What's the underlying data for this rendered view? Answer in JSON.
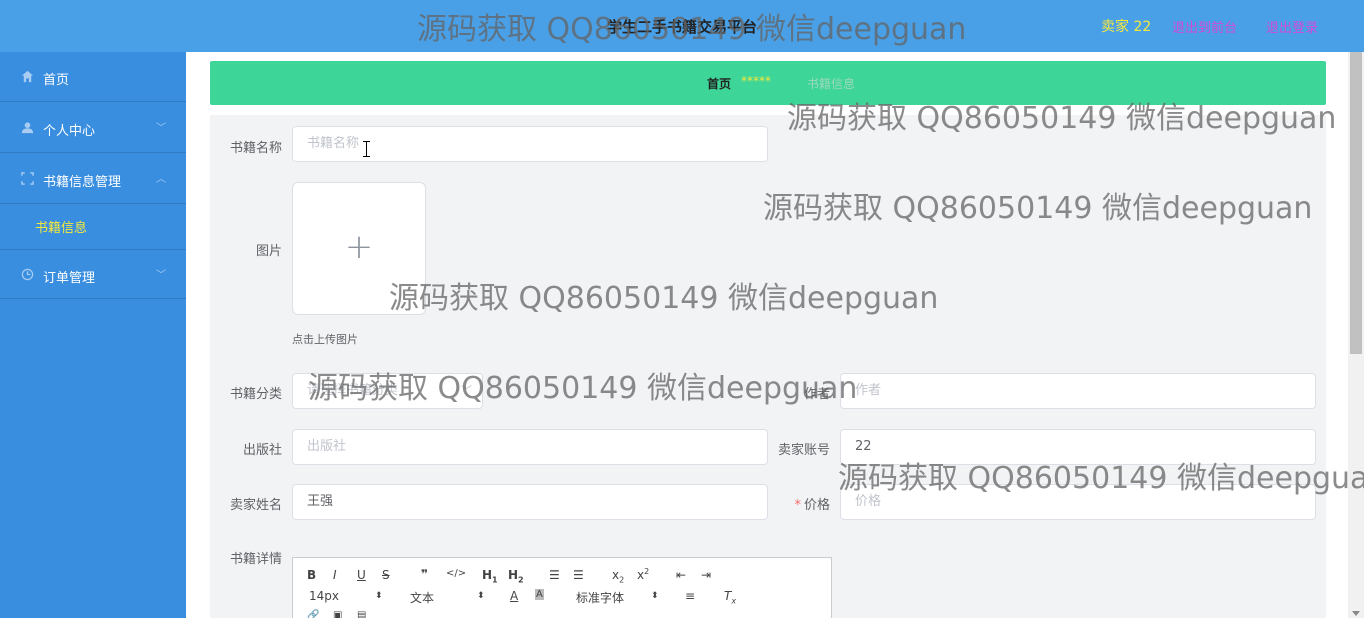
{
  "header": {
    "title": "学生二手书籍交易平台",
    "seller_label": "卖家 22",
    "front_link": "退出到前台",
    "logout_link": "退出登录"
  },
  "sidebar": {
    "items": [
      {
        "label": "首页",
        "icon": "home-icon"
      },
      {
        "label": "个人中心",
        "icon": "user-icon"
      },
      {
        "label": "书籍信息管理",
        "icon": "expand-icon"
      },
      {
        "label": "订单管理",
        "icon": "clock-icon"
      }
    ],
    "sub_item": "书籍信息"
  },
  "breadcrumb": {
    "home": "首页",
    "separator": "*****",
    "current": "书籍信息"
  },
  "form": {
    "book_name_label": "书籍名称",
    "book_name_placeholder": "书籍名称",
    "image_label": "图片",
    "upload_tip": "点击上传图片",
    "category_label": "书籍分类",
    "category_placeholder": "请选择书籍分类",
    "author_label": "作者",
    "author_placeholder": "作者",
    "publisher_label": "出版社",
    "publisher_placeholder": "出版社",
    "seller_account_label": "卖家账号",
    "seller_account_value": "22",
    "seller_name_label": "卖家姓名",
    "seller_name_value": "王强",
    "price_label": "价格",
    "price_required_mark": "*",
    "price_placeholder": "价格",
    "detail_label": "书籍详情"
  },
  "editor": {
    "font_size": "14px",
    "text_type": "文本",
    "font_family": "标准字体"
  },
  "watermark": "源码获取 QQ86050149 微信deepguan",
  "colors": {
    "header_bg": "#4aa0e6",
    "sidebar_bg": "#3a8ee0",
    "breadcrumb_bg": "#3ed598",
    "accent_yellow": "#f5e83c",
    "link_purple": "#d04bd8"
  }
}
